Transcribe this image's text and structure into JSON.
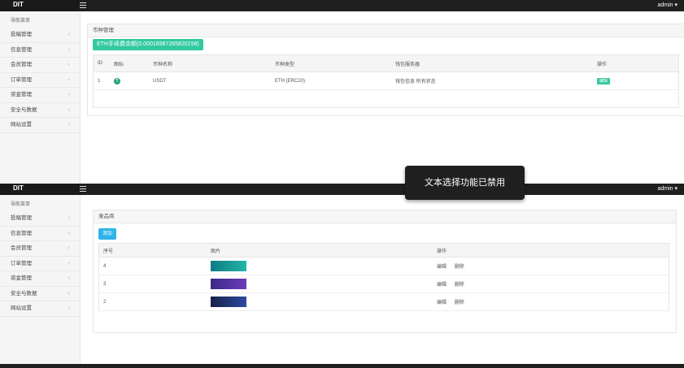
{
  "app": {
    "logo": "DIT",
    "user": "admin ▾"
  },
  "sidebar": {
    "nav_title": "导航菜单",
    "items": [
      {
        "label": "投稿管理"
      },
      {
        "label": "信息管理"
      },
      {
        "label": "会员管理"
      },
      {
        "label": "订单管理"
      },
      {
        "label": "资金管理"
      },
      {
        "label": "安全与数据"
      },
      {
        "label": "网站设置"
      }
    ]
  },
  "coin_panel": {
    "title": "币种管理",
    "fee_button": "ETH手续费余额(0.00016987265820158)",
    "columns": [
      "ID",
      "图标",
      "币种名称",
      "币种类型",
      "钱包服务器",
      "操作"
    ],
    "rows": [
      {
        "id": "1",
        "icon": "T",
        "name": "USDT",
        "type": "ETH (ERC20)",
        "server": "钱包信息 所有状态",
        "action": "编辑"
      }
    ]
  },
  "banner_panel": {
    "title": "录品商",
    "add_button": "添加",
    "columns": [
      "序号",
      "图片",
      "操作"
    ],
    "rows": [
      {
        "index": "4",
        "banner_color": "#0e7a86",
        "edit": "编辑",
        "delete": "删除"
      },
      {
        "index": "3",
        "banner_color": "#3b2a8a",
        "edit": "编辑",
        "delete": "删除"
      },
      {
        "index": "2",
        "banner_color": "#16224a",
        "edit": "编辑",
        "delete": "删除"
      }
    ]
  },
  "toast": {
    "text": "文本选择功能已禁用"
  },
  "colors": {
    "topbar": "#1f1f1f",
    "accent_green": "#32c9a0",
    "accent_blue": "#2fb4e9"
  }
}
